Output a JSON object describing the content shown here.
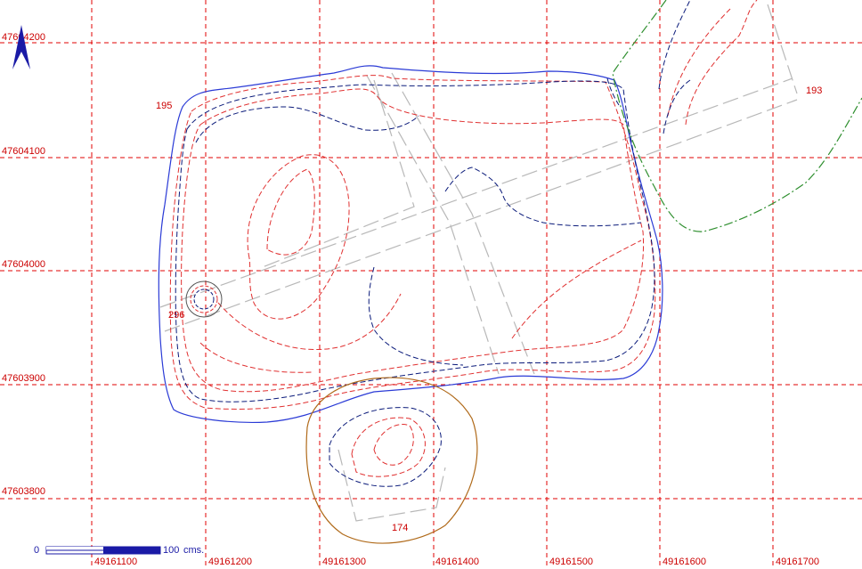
{
  "map": {
    "grid": {
      "x_labels": [
        "49161100",
        "49161200",
        "49161300",
        "49161400",
        "49161500",
        "49161600",
        "49161700"
      ],
      "y_labels": [
        "47604200",
        "47604100",
        "47604000",
        "47603900",
        "47603800"
      ],
      "line_color": "#e00000"
    },
    "feature_labels": {
      "a": "195",
      "b": "193",
      "c": "296",
      "d": "174"
    },
    "scale_bar": {
      "start": "0",
      "end": "100",
      "unit": "cms."
    },
    "colors": {
      "boundary": "#2b3bd6",
      "contour_red": "#e03030",
      "contour_navy": "#0a1a7a",
      "road": "#b8b8b8",
      "green": "#2f8f2f",
      "brown": "#b06a1a",
      "north_arrow": "#1a1aa6"
    },
    "north_arrow_icon": "north-arrow-icon"
  }
}
